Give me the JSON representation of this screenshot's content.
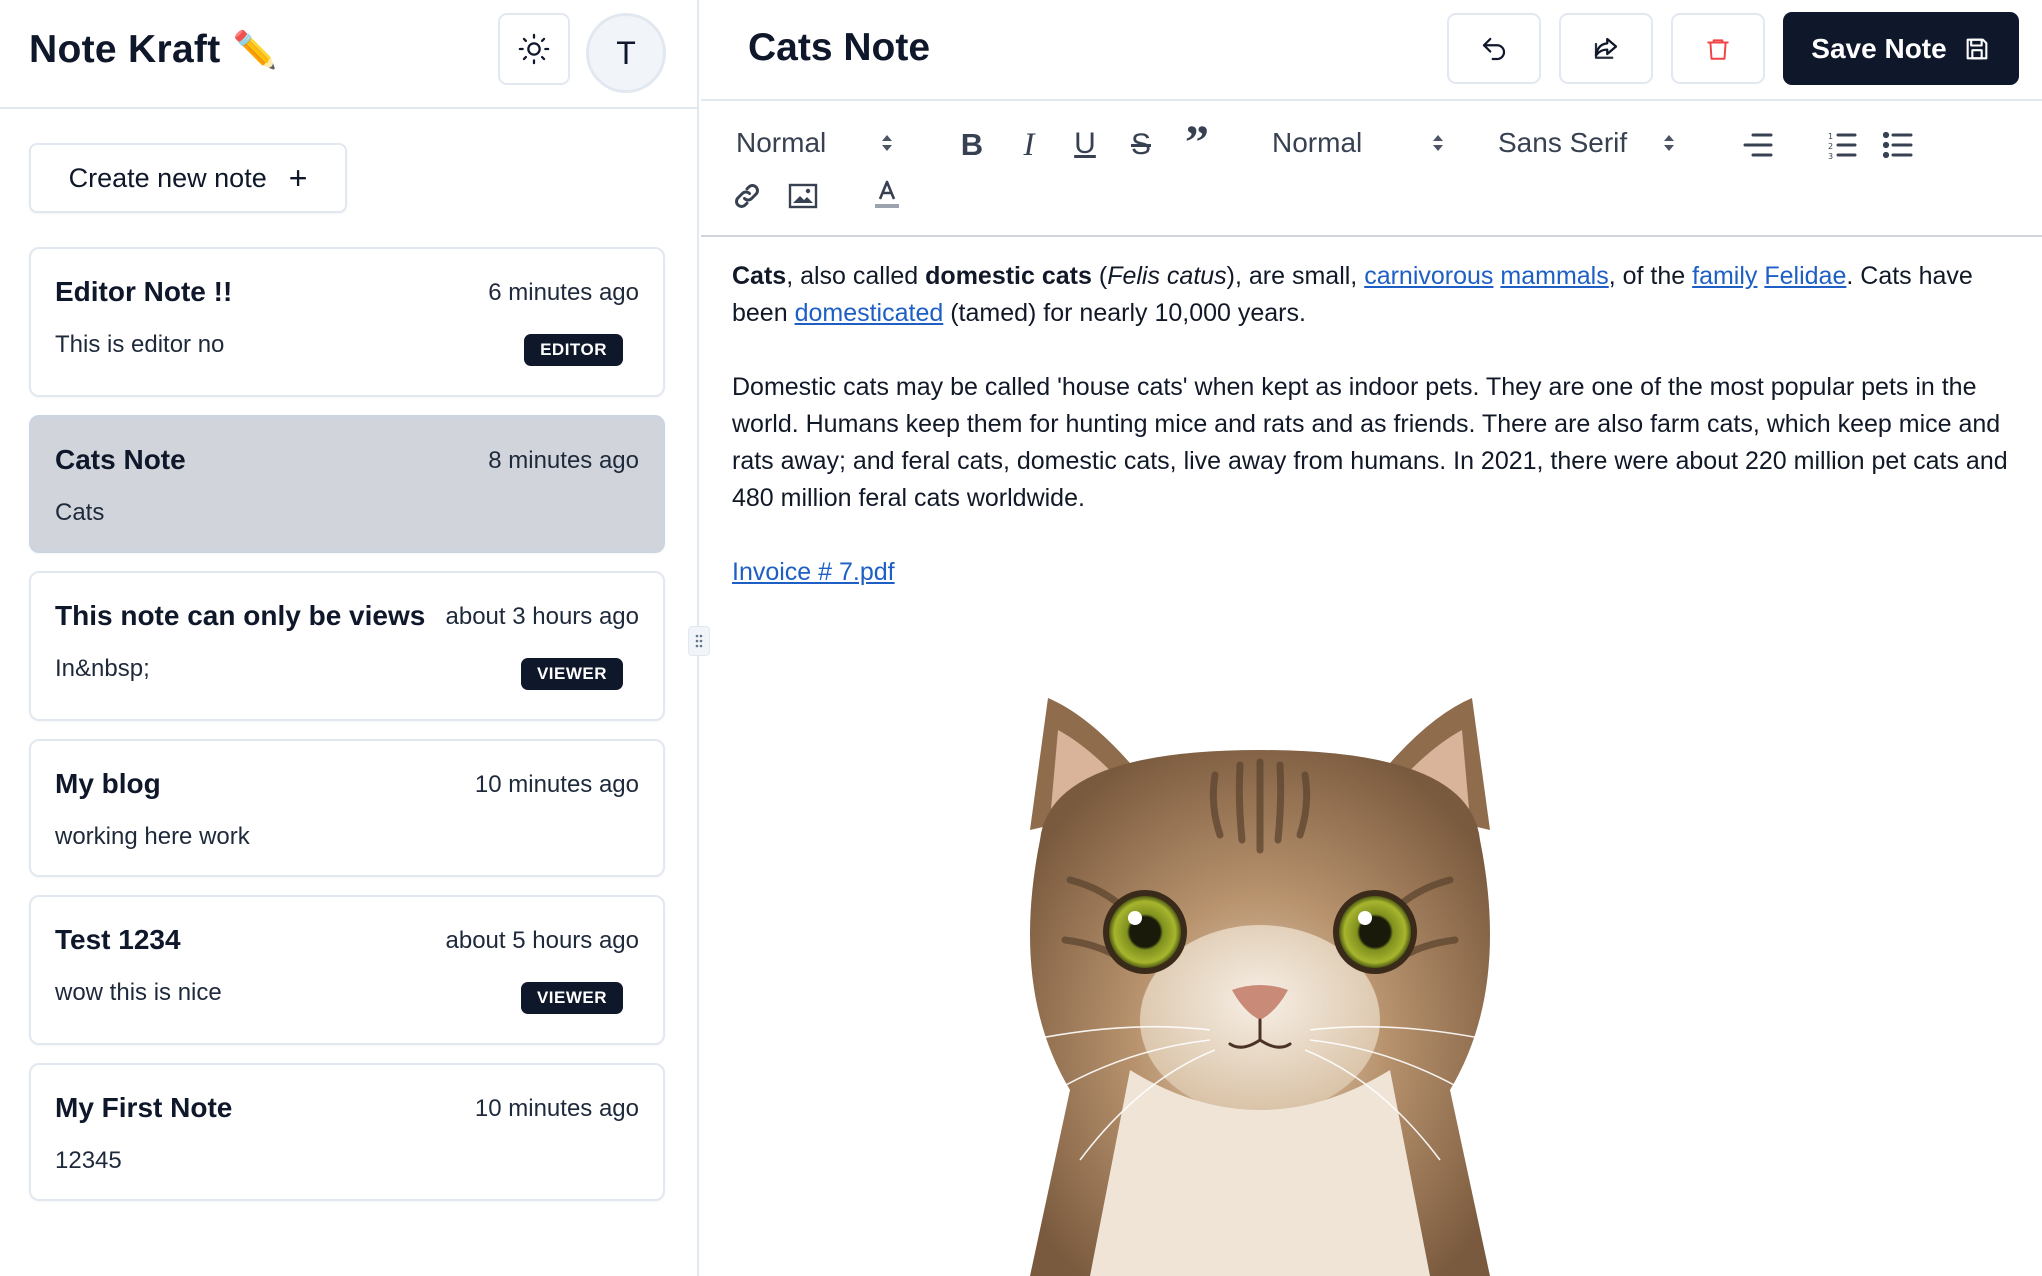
{
  "app": {
    "title": "Note Kraft",
    "title_emoji": "✏️",
    "avatar_initial": "T"
  },
  "sidebar": {
    "create_button_label": "Create new note",
    "create_button_icon": "+",
    "notes": [
      {
        "title": "Editor Note !!",
        "time": "6 minutes ago",
        "preview": "This is editor no",
        "badge": "EDITOR",
        "active": false
      },
      {
        "title": "Cats Note",
        "time": "8 minutes ago",
        "preview": "Cats",
        "badge": "",
        "active": true
      },
      {
        "title": "This note can only be views",
        "time": "about 3 hours ago",
        "preview": "In&nbsp;",
        "badge": "VIEWER",
        "active": false
      },
      {
        "title": "My blog",
        "time": "10 minutes ago",
        "preview": "working here work",
        "badge": "",
        "active": false
      },
      {
        "title": "Test 1234",
        "time": "about 5 hours ago",
        "preview": "wow this is nice",
        "badge": "VIEWER",
        "active": false
      },
      {
        "title": "My First Note",
        "time": "10 minutes ago",
        "preview": "12345",
        "badge": "",
        "active": false
      }
    ]
  },
  "editor": {
    "title": "Cats Note",
    "save_label": "Save Note",
    "toolbar": {
      "heading_select": "Normal",
      "size_select": "Normal",
      "font_select": "Sans Serif"
    },
    "content": {
      "p1": {
        "cats": "Cats",
        "t1": ", also called ",
        "domestic_cats": "domestic cats",
        "t2": " (",
        "felis": "Felis catus",
        "t3": "), are small, ",
        "link_carnivorous": "carnivorous",
        "t4": " ",
        "link_mammals": "mammals",
        "t5": ", of the ",
        "link_family": "family",
        "t6": " ",
        "link_felidae": "Felidae",
        "t7": ". Cats have been ",
        "link_domesticated": "domesticated",
        "t8": " (tamed) for nearly 10,000 years."
      },
      "p2": "Domestic cats may be called 'house cats' when kept as indoor pets. They are one of the most popular pets in the world. Humans keep them for hunting mice and rats and as friends. There are also farm cats, which keep mice and rats away; and feral cats, domestic cats, live away from humans. In 2021, there were about 220 million pet cats and 480 million feral cats worldwide.",
      "attachment_link": "Invoice # 7.pdf"
    }
  },
  "colors": {
    "primary": "#0f172a",
    "border": "#e2e8f0",
    "active_card": "#d1d5db",
    "link": "#1d5fc4",
    "danger": "#ef4444"
  },
  "icons": {
    "theme": "sun-icon",
    "undo": "undo-icon",
    "share": "share-icon",
    "delete": "trash-icon",
    "save": "save-icon"
  }
}
